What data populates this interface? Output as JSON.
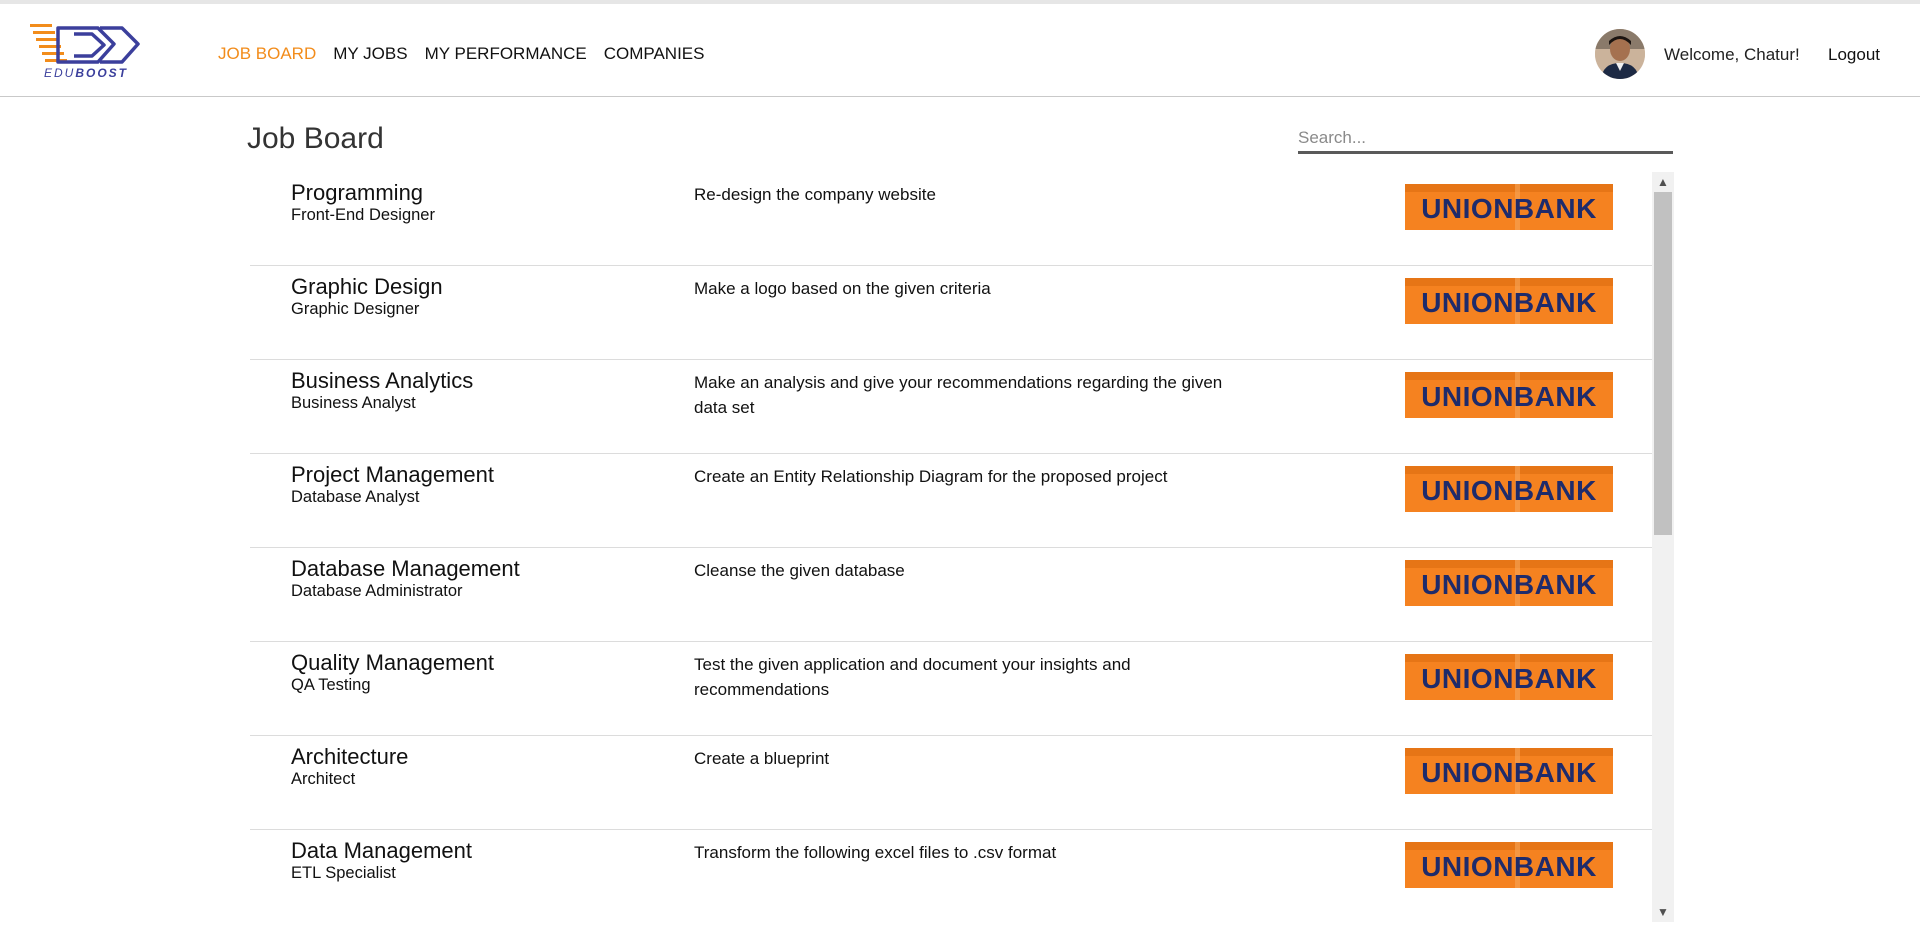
{
  "brand": {
    "prefix": "EDU",
    "suffix": "BOOST",
    "colors": {
      "accent": "#f28c1b",
      "logo_blue": "#3b3f9c"
    }
  },
  "nav": {
    "items": [
      {
        "label": "JOB BOARD",
        "active": true
      },
      {
        "label": "MY JOBS",
        "active": false
      },
      {
        "label": "MY PERFORMANCE",
        "active": false
      },
      {
        "label": "COMPANIES",
        "active": false
      }
    ]
  },
  "user": {
    "welcome": "Welcome, Chatur!",
    "logout_label": "Logout",
    "avatar_icon": "user-avatar"
  },
  "page": {
    "title": "Job Board",
    "search_placeholder": "Search..."
  },
  "jobs": [
    {
      "category": "Programming",
      "role": "Front-End Designer",
      "description": "Re-design the company website",
      "company": "UNIONBANK"
    },
    {
      "category": "Graphic Design",
      "role": "Graphic Designer",
      "description": "Make a logo based on the given criteria",
      "company": "UNIONBANK"
    },
    {
      "category": "Business Analytics",
      "role": "Business Analyst",
      "description": "Make an analysis and give your recommendations regarding the given data set",
      "company": "UNIONBANK"
    },
    {
      "category": "Project Management",
      "role": "Database Analyst",
      "description": "Create an Entity Relationship Diagram for the proposed project",
      "company": "UNIONBANK"
    },
    {
      "category": "Database Management",
      "role": "Database Administrator",
      "description": "Cleanse the given database",
      "company": "UNIONBANK"
    },
    {
      "category": "Quality Management",
      "role": "QA Testing",
      "description": "Test the given application and document your insights and recommendations",
      "company": "UNIONBANK"
    },
    {
      "category": "Architecture",
      "role": "Architect",
      "description": "Create a blueprint",
      "company": "UNIONBANK"
    },
    {
      "category": "Data Management",
      "role": "ETL Specialist",
      "description": "Transform the following excel files to .csv format",
      "company": "UNIONBANK"
    }
  ],
  "company_logo_colors": {
    "background": "#f58220",
    "text": "#1e2b6b"
  }
}
